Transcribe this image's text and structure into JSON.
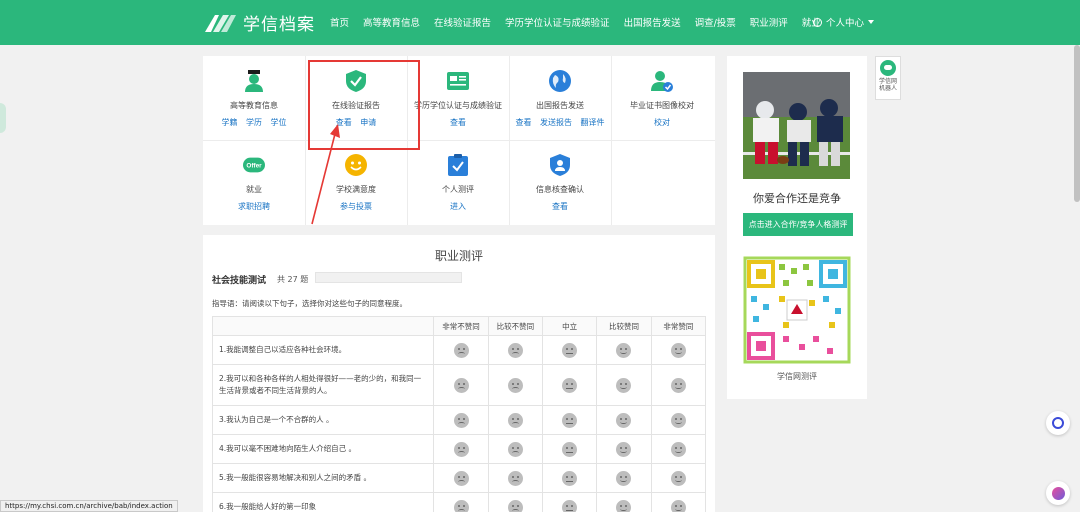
{
  "header": {
    "logo_text": "学信档案",
    "nav": [
      "首页",
      "高等教育信息",
      "在线验证报告",
      "学历学位认证与成绩验证",
      "出国报告发送",
      "调查/投票",
      "职业测评",
      "就业"
    ],
    "user_menu": "个人中心"
  },
  "services": [
    {
      "name": "高等教育信息",
      "links": [
        "学籍",
        "学历",
        "学位"
      ],
      "icon": "graduate-icon"
    },
    {
      "name": "在线验证报告",
      "links": [
        "查看",
        "申请"
      ],
      "icon": "shield-check-icon"
    },
    {
      "name": "学历学位认证与成绩验证",
      "links": [
        "查看"
      ],
      "icon": "certificate-icon"
    },
    {
      "name": "出国报告发送",
      "links": [
        "查看",
        "发送报告",
        "翻译件"
      ],
      "icon": "globe-icon"
    },
    {
      "name": "毕业证书图像校对",
      "links": [
        "校对"
      ],
      "icon": "user-check-icon"
    },
    {
      "name": "就业",
      "links": [
        "求职招聘"
      ],
      "icon": "offer-icon"
    },
    {
      "name": "学校满意度",
      "links": [
        "参与投票"
      ],
      "icon": "smile-icon"
    },
    {
      "name": "个人测评",
      "links": [
        "进入"
      ],
      "icon": "clipboard-check-icon"
    },
    {
      "name": "信息核查确认",
      "links": [
        "查看"
      ],
      "icon": "user-badge-icon"
    }
  ],
  "assessment": {
    "title": "职业测评",
    "subtitle": "社会技能测试",
    "count": "共 27 题",
    "guide": "指导语：请阅读以下句子，选择你对这些句子的同意程度。",
    "columns": [
      "非常不赞同",
      "比较不赞同",
      "中立",
      "比较赞同",
      "非常赞同"
    ],
    "questions": [
      "1.我能调整自己以适应各种社会环境。",
      "2.我可以和各种各样的人相处得很好——老的少的，和我同一生活背景或者不同生活背景的人。",
      "3.我认为自己是一个不合群的人 。",
      "4.我可以毫不困难地向陌生人介绍自己 。",
      "5.我一般能很容易地解决和别人之间的矛盾 。",
      "6.我一般能给人好的第一印象"
    ]
  },
  "sidebar": {
    "promo_title": "你爱合作还是竞争",
    "promo_button": "点击进入合作/竞争人格测评",
    "qr_caption": "学信网测评"
  },
  "robot": {
    "line1": "学信网",
    "line2": "机器人"
  },
  "status_url": "https://my.chsi.com.cn/archive/bab/index.action",
  "colors": {
    "brand": "#2bb77c",
    "link": "#1a74c4",
    "highlight": "#e53935"
  }
}
